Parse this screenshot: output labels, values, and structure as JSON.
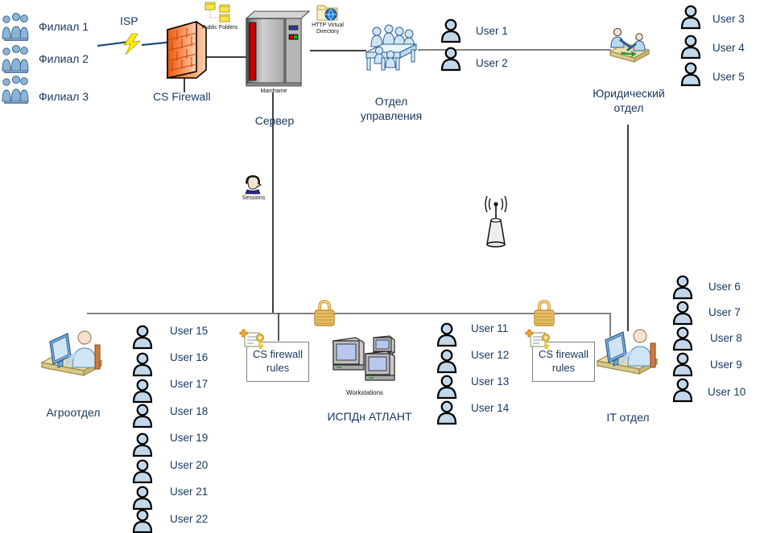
{
  "diagram": {
    "title": "Network topology diagram",
    "colors": {
      "label_text": "#17375e",
      "line": "#808080",
      "firewall": "#f4792a",
      "lock": "#e8bb52",
      "bolt": "#ffec00"
    },
    "branches": [
      {
        "label": "Филиал 1"
      },
      {
        "label": "Филиал 2"
      },
      {
        "label": "Филиал 3"
      }
    ],
    "isp_label": "ISP",
    "firewall_label": "CS Firewall",
    "public_folders_label": "Public Folders",
    "http_virtual_directory_label": "HTTP Virtual\nDirectory",
    "mainframe_label": "Mainframe",
    "server_label": "Сервер",
    "sessions_label": "Sessions",
    "management_label": "Отдел\nуправления",
    "legal_label": "Юридический\nотдел",
    "agro_label": "Агроотдел",
    "it_label": "IT отдел",
    "workstations_label": "Workstations",
    "ispdn_label": "ИСПДн АТЛАНТ",
    "firewall_rules_left_label": "CS firewall\nrules",
    "firewall_rules_right_label": "CS firewall\nrules",
    "users_top_middle": [
      {
        "label": "User 1"
      },
      {
        "label": "User 2"
      }
    ],
    "users_top_right": [
      {
        "label": "User 3"
      },
      {
        "label": "User 4"
      },
      {
        "label": "User 5"
      }
    ],
    "users_bottom_right": [
      {
        "label": "User 6"
      },
      {
        "label": "User 7"
      },
      {
        "label": "User 8"
      },
      {
        "label": "User 9"
      },
      {
        "label": "User 10"
      }
    ],
    "users_center": [
      {
        "label": "User 11"
      },
      {
        "label": "User 12"
      },
      {
        "label": "User 13"
      },
      {
        "label": "User 14"
      }
    ],
    "users_agro": [
      {
        "label": "User 15"
      },
      {
        "label": "User 16"
      },
      {
        "label": "User 17"
      },
      {
        "label": "User 18"
      },
      {
        "label": "User 19"
      },
      {
        "label": "User 20"
      },
      {
        "label": "User 21"
      },
      {
        "label": "User 22"
      }
    ]
  }
}
